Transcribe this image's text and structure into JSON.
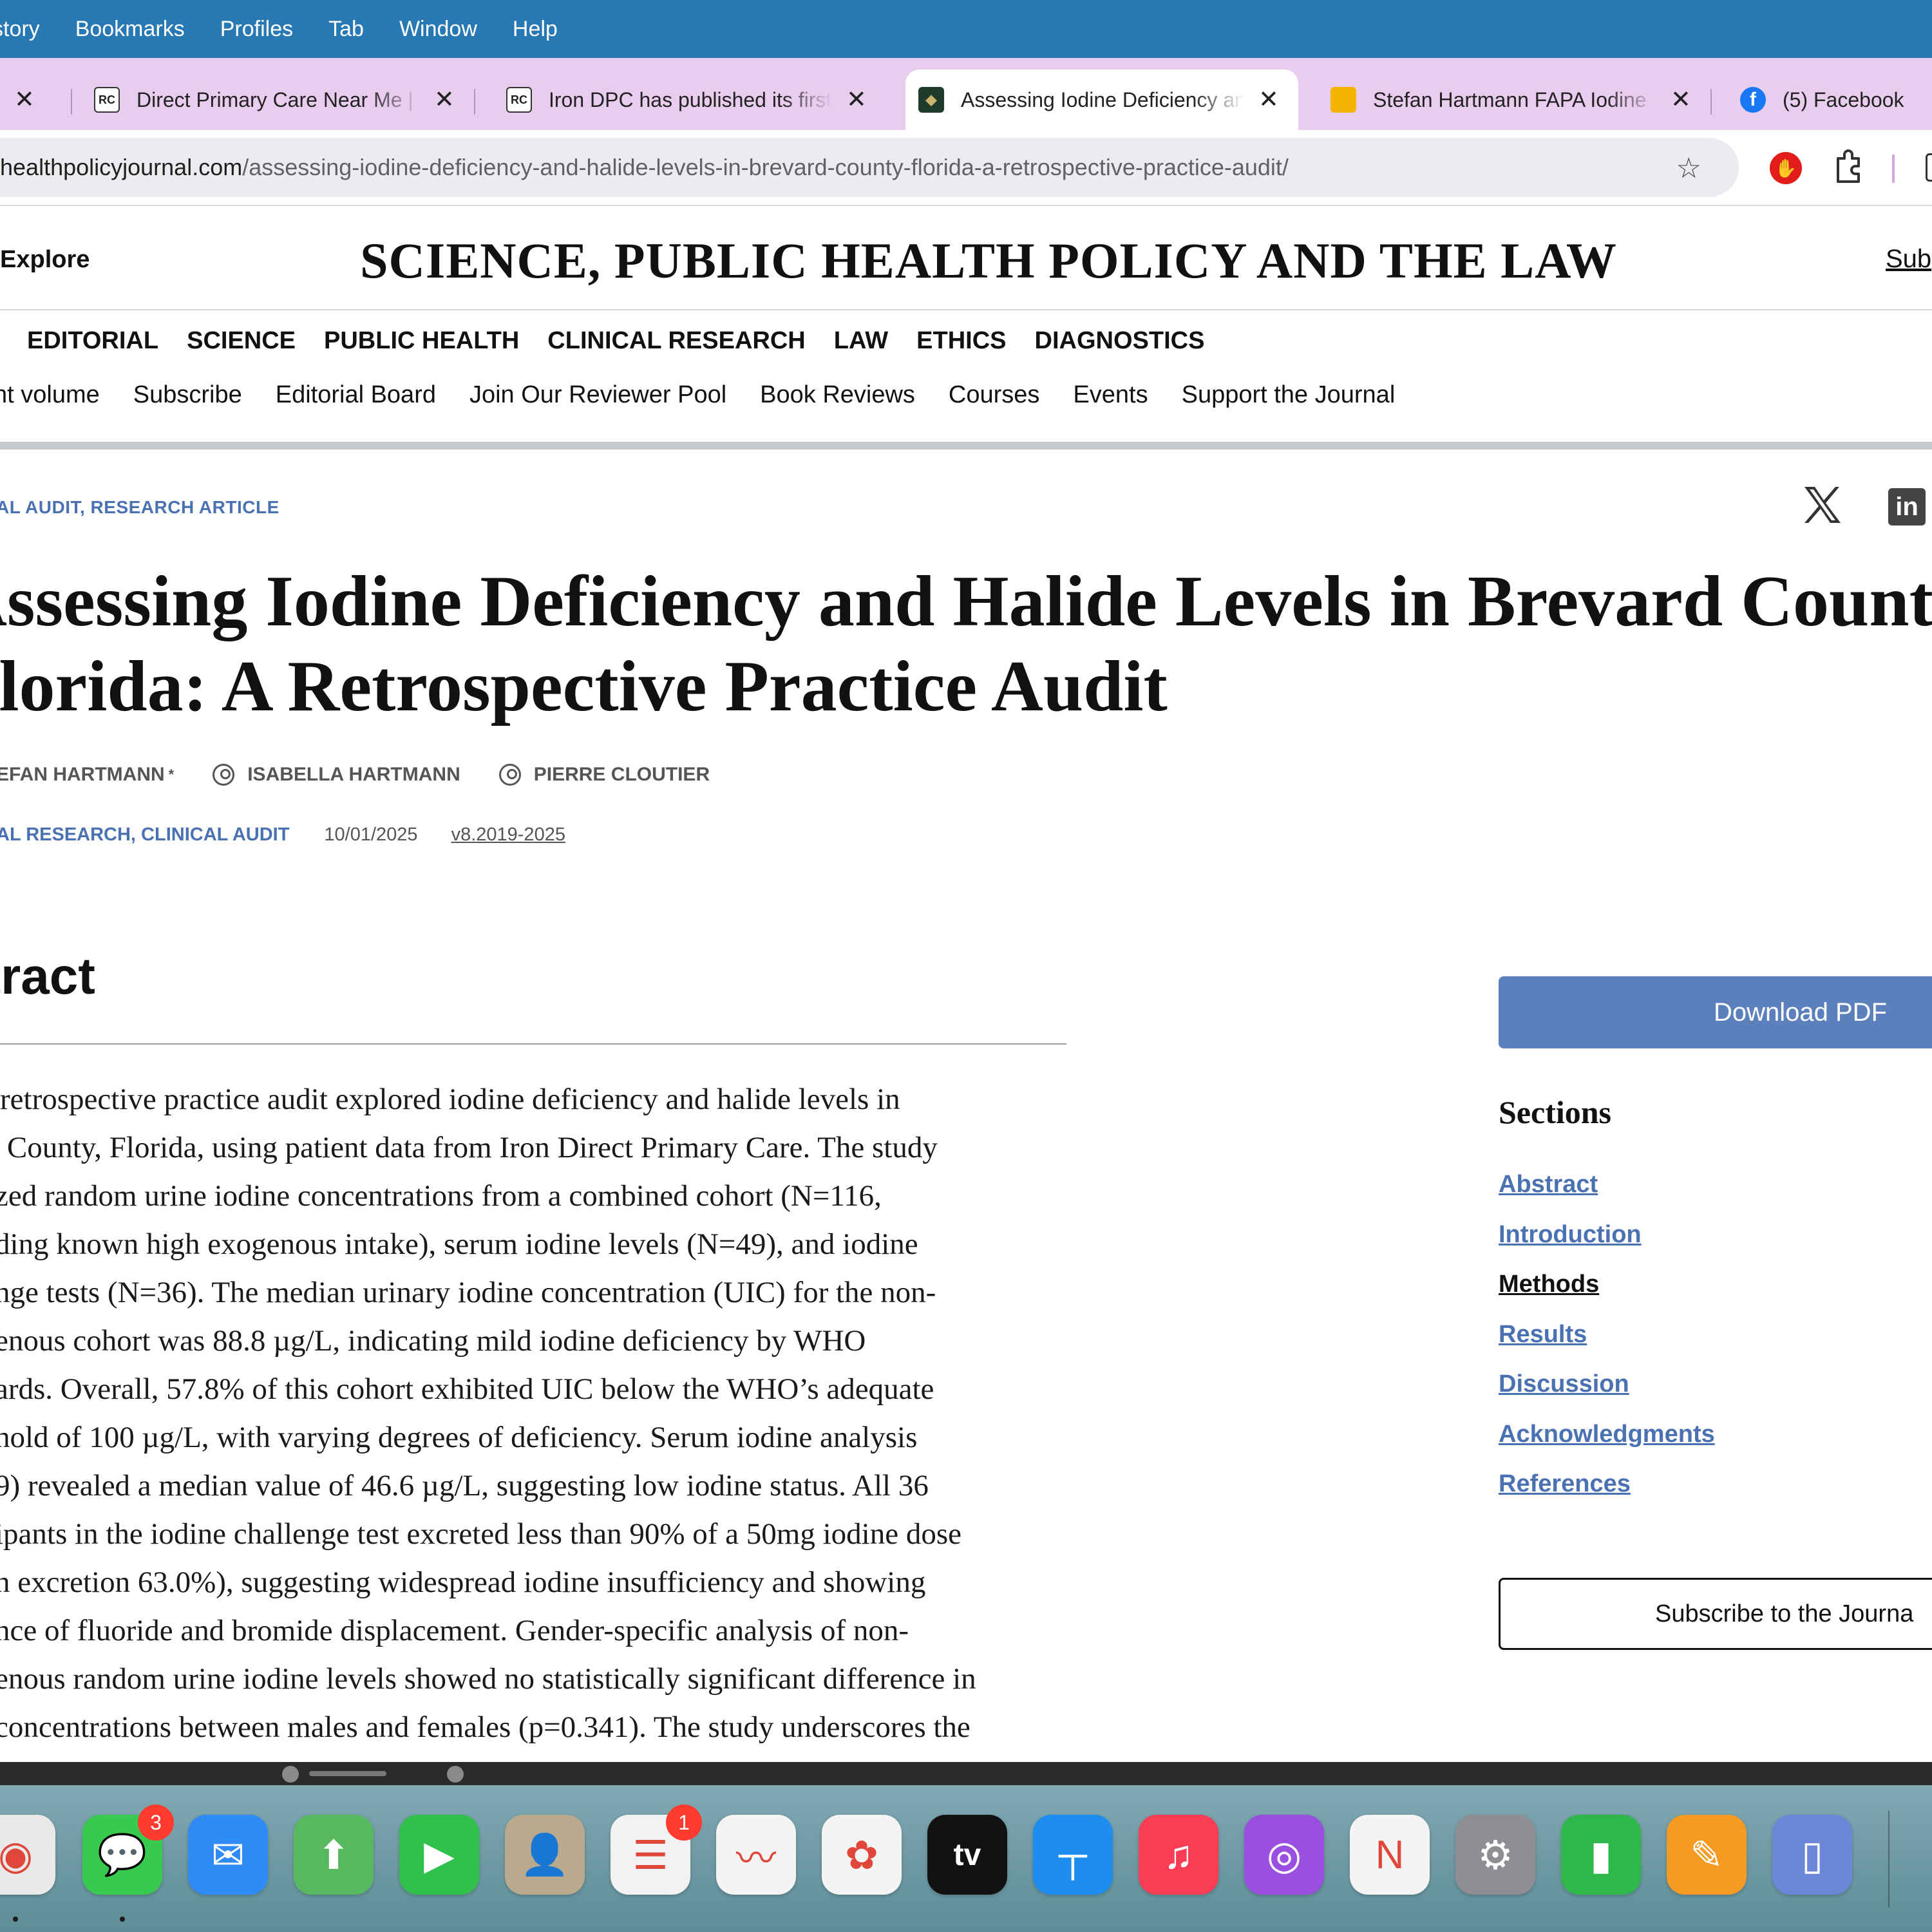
{
  "menubar": {
    "items": [
      "story",
      "Bookmarks",
      "Profiles",
      "Tab",
      "Window",
      "Help"
    ]
  },
  "tabs": [
    {
      "title": "",
      "favicon": "none",
      "active": false
    },
    {
      "title": "Direct Primary Care Near Me |",
      "favicon": "rc-icon",
      "active": false
    },
    {
      "title": "Iron DPC has published its first",
      "favicon": "rc-icon",
      "active": false
    },
    {
      "title": "Assessing Iodine Deficiency and",
      "favicon": "journal-icon",
      "active": true
    },
    {
      "title": "Stefan Hartmann FAPA Iodine",
      "favicon": "slides-icon",
      "active": false
    },
    {
      "title": "(5) Facebook",
      "favicon": "facebook-icon",
      "active": false
    }
  ],
  "tab_close_glyph": "✕",
  "address_bar": {
    "domain": "healthpolicyjournal.com",
    "path": "/assessing-iodine-deficiency-and-halide-levels-in-brevard-county-florida-a-retrospective-practice-audit/"
  },
  "site": {
    "explore": "Explore",
    "masthead": "SCIENCE, PUBLIC HEALTH POLICY AND THE LAW",
    "subscribe_link": "Sub",
    "categories": [
      "EDITORIAL",
      "SCIENCE",
      "PUBLIC HEALTH",
      "CLINICAL RESEARCH",
      "LAW",
      "ETHICS",
      "DIAGNOSTICS"
    ],
    "subnav": [
      "nt volume",
      "Subscribe",
      "Editorial Board",
      "Join Our Reviewer Pool",
      "Book Reviews",
      "Courses",
      "Events",
      "Support the Journal"
    ]
  },
  "article": {
    "kicker": "AL AUDIT, RESEARCH ARTICLE",
    "title_lines": [
      "Assessing Iodine Deficiency and Halide Levels in Brevard County,",
      "Florida: A Retrospective Practice Audit"
    ],
    "authors": [
      {
        "name": "EFAN HARTMANN",
        "mark": "*"
      },
      {
        "name": "ISABELLA HARTMANN",
        "mark": ""
      },
      {
        "name": "PIERRE CLOUTIER",
        "mark": ""
      }
    ],
    "meta": {
      "categories": "AL RESEARCH, CLINICAL AUDIT",
      "date": "10/01/2025",
      "version": "v8.2019-2025"
    },
    "abstract_heading": "stract",
    "abstract_lines": [
      "retrospective practice audit explored iodine deficiency and halide levels in",
      "rd County, Florida, using patient data from Iron Direct Primary Care. The study",
      "zed random urine iodine concentrations from a combined cohort (N=116,",
      "ding known high exogenous intake), serum iodine levels (N=49), and iodine",
      "nge tests (N=36). The median urinary iodine concentration (UIC) for the non-",
      "enous cohort was 88.8 µg/L, indicating mild iodine deficiency by WHO",
      "ards. Overall, 57.8% of this cohort exhibited UIC below the WHO’s adequate",
      "hold of 100 µg/L, with varying degrees of deficiency. Serum iodine analysis",
      "9) revealed a median value of 46.6 µg/L, suggesting low iodine status. All 36",
      "ipants in the iodine challenge test excreted less than 90% of a 50mg iodine dose",
      "n excretion 63.0%), suggesting widespread iodine insufficiency and showing",
      "nce of fluoride and bromide displacement. Gender-specific analysis of non-",
      "enous random urine iodine levels showed no statistically significant difference in",
      " concentrations between males and females (p=0.341). The study underscores the"
    ]
  },
  "sidebar": {
    "download_pdf": "Download PDF",
    "sections_heading": "Sections",
    "sections": [
      "Abstract",
      "Introduction",
      "Methods",
      "Results",
      "Discussion",
      "Acknowledgments",
      "References"
    ],
    "current_section": "Methods",
    "subscribe_button": "Subscribe to the Journa"
  },
  "dock": {
    "apps": [
      {
        "name": "chrome-icon",
        "glyph": "◉",
        "color": "#e9e9e9",
        "badge": "",
        "running": true
      },
      {
        "name": "messages-icon",
        "glyph": "💬",
        "color": "#38c94f",
        "badge": "3",
        "running": true
      },
      {
        "name": "mail-icon",
        "glyph": "✉",
        "color": "#2f8bf5",
        "badge": "",
        "running": false
      },
      {
        "name": "maps-icon",
        "glyph": "⬆",
        "color": "#58b85f",
        "badge": "",
        "running": false
      },
      {
        "name": "facetime-icon",
        "glyph": "▶",
        "color": "#2fc14a",
        "badge": "",
        "running": false
      },
      {
        "name": "contacts-icon",
        "glyph": "👤",
        "color": "#b9a98d",
        "badge": "",
        "running": false
      },
      {
        "name": "reminders-icon",
        "glyph": "☰",
        "color": "#f2f2f2",
        "badge": "1",
        "running": false
      },
      {
        "name": "freeform-icon",
        "glyph": "〰",
        "color": "#f4f4f4",
        "badge": "",
        "running": false
      },
      {
        "name": "photos-icon",
        "glyph": "✿",
        "color": "#f4f4f4",
        "badge": "",
        "running": false
      },
      {
        "name": "apple-tv-icon",
        "glyph": "tv",
        "color": "#111111",
        "badge": "",
        "running": false
      },
      {
        "name": "keynote-icon",
        "glyph": "┬",
        "color": "#1d8ef0",
        "badge": "",
        "running": false
      },
      {
        "name": "music-icon",
        "glyph": "♫",
        "color": "#fa3d55",
        "badge": "",
        "running": false
      },
      {
        "name": "podcasts-icon",
        "glyph": "◎",
        "color": "#9b4fe0",
        "badge": "",
        "running": false
      },
      {
        "name": "news-icon",
        "glyph": "N",
        "color": "#f4f4f4",
        "badge": "",
        "running": false
      },
      {
        "name": "system-settings-icon",
        "glyph": "⚙",
        "color": "#8e8e93",
        "badge": "",
        "running": false
      },
      {
        "name": "numbers-icon",
        "glyph": "▮",
        "color": "#2fb84a",
        "badge": "",
        "running": false
      },
      {
        "name": "pages-icon",
        "glyph": "✎",
        "color": "#f59a23",
        "badge": "",
        "running": false
      },
      {
        "name": "iphone-mirroring-icon",
        "glyph": "▯",
        "color": "#6c86d8",
        "badge": "",
        "running": false
      }
    ]
  }
}
